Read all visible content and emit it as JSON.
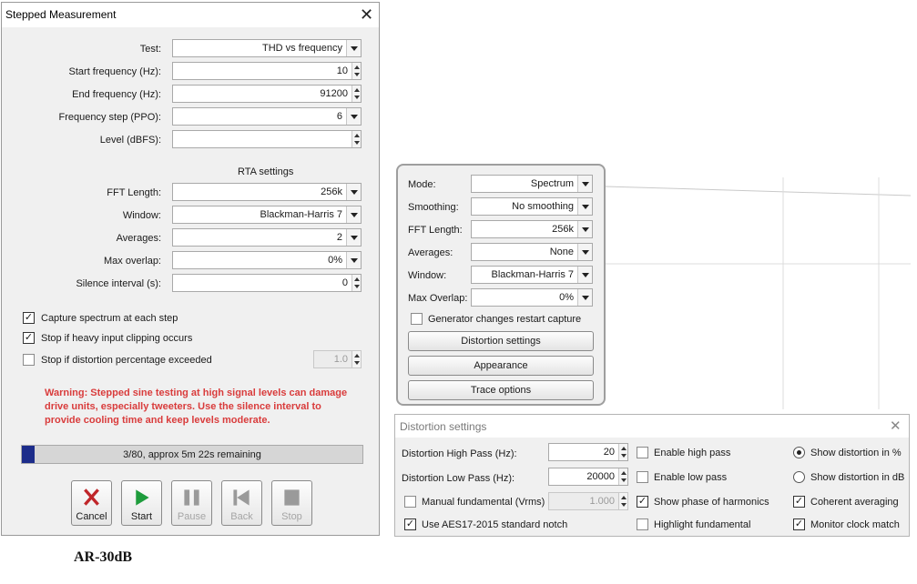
{
  "stepped": {
    "title": "Stepped Measurement",
    "rows": [
      {
        "label": "Test:",
        "value": "THD vs frequency"
      },
      {
        "label": "Start frequency (Hz):",
        "value": "10"
      },
      {
        "label": "End frequency (Hz):",
        "value": "91200"
      },
      {
        "label": "Frequency step (PPO):",
        "value": "6"
      },
      {
        "label": "Level (dBFS):",
        "value": ""
      }
    ],
    "rta_heading": "RTA settings",
    "rta_rows": [
      {
        "label": "FFT Length:",
        "value": "256k"
      },
      {
        "label": "Window:",
        "value": "Blackman-Harris 7"
      },
      {
        "label": "Averages:",
        "value": "2"
      },
      {
        "label": "Max overlap:",
        "value": "0%"
      },
      {
        "label": "Silence interval (s):",
        "value": "0"
      }
    ],
    "checks": [
      {
        "label": "Capture spectrum at each step",
        "checked": true
      },
      {
        "label": "Stop if heavy input clipping occurs",
        "checked": true
      },
      {
        "label": "Stop if distortion percentage exceeded",
        "checked": false
      }
    ],
    "distortion_limit": "1.0",
    "warning": "Warning: Stepped sine testing at high signal levels can damage drive units, especially tweeters. Use the silence interval to provide cooling time and keep levels moderate.",
    "progress": {
      "text": "3/80, approx 5m 22s remaining",
      "fraction": 0.0375
    },
    "buttons": {
      "cancel": "Cancel",
      "start": "Start",
      "pause": "Pause",
      "back": "Back",
      "stop": "Stop"
    }
  },
  "rta": {
    "rows": [
      {
        "label": "Mode:",
        "value": "Spectrum"
      },
      {
        "label": "Smoothing:",
        "value": "No  smoothing"
      },
      {
        "label": "FFT Length:",
        "value": "256k"
      },
      {
        "label": "Averages:",
        "value": "None"
      },
      {
        "label": "Window:",
        "value": "Blackman-Harris 7"
      },
      {
        "label": "Max Overlap:",
        "value": "0%"
      }
    ],
    "generator_check": "Generator changes restart capture",
    "buttons": {
      "distortion": "Distortion settings",
      "appearance": "Appearance",
      "trace": "Trace options"
    }
  },
  "distortion": {
    "title": "Distortion settings",
    "high_pass_label": "Distortion High Pass (Hz):",
    "high_pass_value": "20",
    "low_pass_label": "Distortion Low Pass (Hz):",
    "low_pass_value": "20000",
    "manual_fundamental": "Manual fundamental (Vrms)",
    "manual_fundamental_value": "1.000",
    "aes17": "Use AES17-2015 standard notch",
    "enable_high_pass": "Enable high pass",
    "enable_low_pass": "Enable low pass",
    "show_phase": "Show phase of harmonics",
    "highlight_fundamental": "Highlight fundamental",
    "show_percent": "Show distortion in %",
    "show_db": "Show distortion in dB",
    "coherent": "Coherent averaging",
    "monitor_clock": "Monitor clock match"
  },
  "caption": "AR-30dB"
}
